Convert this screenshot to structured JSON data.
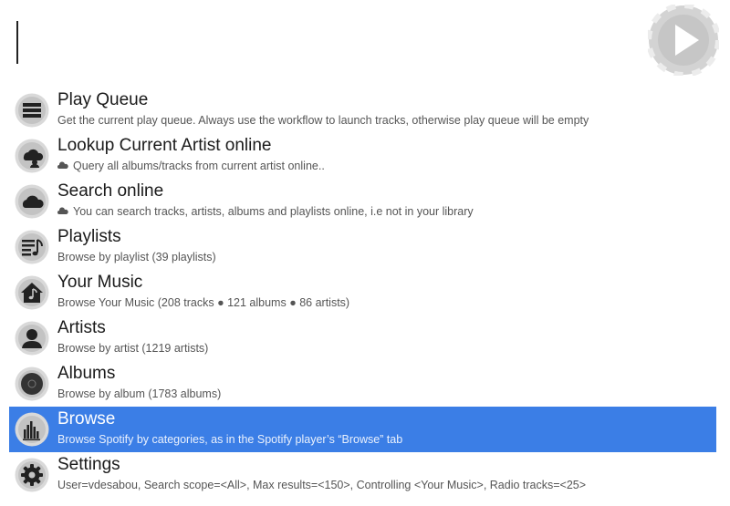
{
  "search": {
    "query": ""
  },
  "colors": {
    "selected_bg": "#3b7ee6",
    "title": "#1a1a1a",
    "subtitle": "#555555"
  },
  "results": [
    {
      "icon": "queue-icon",
      "title": "Play Queue",
      "subtitle": "Get the current play queue. Always use the workflow to launch tracks, otherwise play queue will be empty"
    },
    {
      "icon": "cloud-user-icon",
      "title": "Lookup Current Artist online",
      "subtitle": "Query all albums/tracks from current artist online..",
      "subtitle_icon": "cloud-icon"
    },
    {
      "icon": "cloud-icon",
      "title": "Search online",
      "subtitle": "You can search tracks, artists, albums and playlists online, i.e not in your library",
      "subtitle_icon": "cloud-icon"
    },
    {
      "icon": "playlist-icon",
      "title": "Playlists",
      "subtitle": "Browse by playlist (39 playlists)"
    },
    {
      "icon": "home-music-icon",
      "title": "Your Music",
      "subtitle": "Browse Your Music (208 tracks ● 121  albums ● 86 artists)"
    },
    {
      "icon": "person-icon",
      "title": "Artists",
      "subtitle": "Browse by artist (1219 artists)"
    },
    {
      "icon": "album-disc-icon",
      "title": "Albums",
      "subtitle": "Browse by album (1783 albums)"
    },
    {
      "icon": "equalizer-icon",
      "title": "Browse",
      "subtitle": "Browse Spotify by categories, as in the Spotify player’s “Browse” tab",
      "selected": true
    },
    {
      "icon": "gear-icon",
      "title": "Settings",
      "subtitle": "User=vdesabou, Search scope=<All>, Max results=<150>, Controlling <Your Music>, Radio tracks=<25>"
    }
  ]
}
